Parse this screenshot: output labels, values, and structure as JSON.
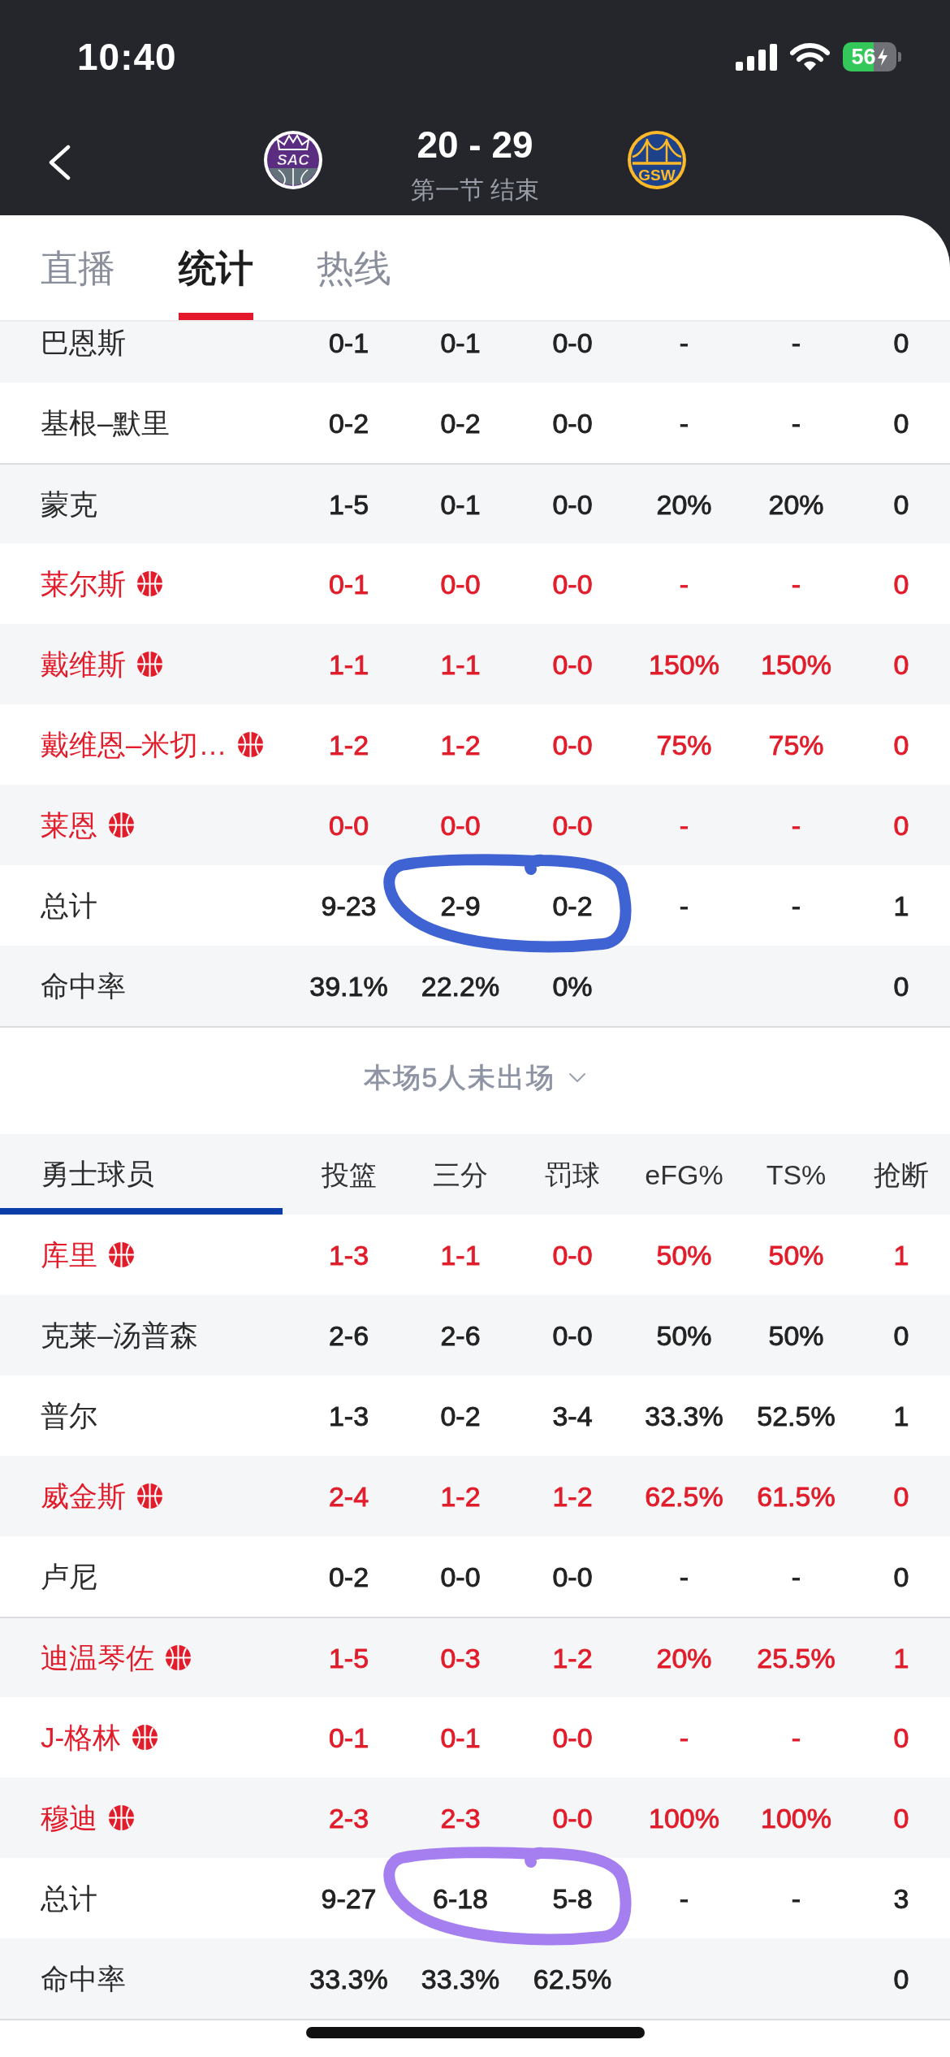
{
  "status_bar": {
    "time": "10:40",
    "battery": "56"
  },
  "header": {
    "home": {
      "logo_text": "SAC"
    },
    "score": "20 - 29",
    "period": "第一节 结束",
    "away": {
      "logo_text": "GSW"
    }
  },
  "tabs": [
    {
      "label": "直播",
      "selected": false
    },
    {
      "label": "统计",
      "selected": true
    },
    {
      "label": "热线",
      "selected": false
    }
  ],
  "tables": [
    {
      "groups": [
        {
          "players": [
            {
              "name": "巴恩斯",
              "on_court": false,
              "stats": [
                "0-1",
                "0-1",
                "0-0",
                "-",
                "-",
                "0"
              ]
            },
            {
              "name": "基根–默里",
              "on_court": false,
              "stats": [
                "0-2",
                "0-2",
                "0-0",
                "-",
                "-",
                "0"
              ]
            }
          ]
        },
        {
          "players": [
            {
              "name": "蒙克",
              "on_court": false,
              "stats": [
                "1-5",
                "0-1",
                "0-0",
                "20%",
                "20%",
                "0"
              ]
            },
            {
              "name": "莱尔斯",
              "on_court": true,
              "stats": [
                "0-1",
                "0-0",
                "0-0",
                "-",
                "-",
                "0"
              ]
            },
            {
              "name": "戴维斯",
              "on_court": true,
              "stats": [
                "1-1",
                "1-1",
                "0-0",
                "150%",
                "150%",
                "0"
              ]
            },
            {
              "name": "戴维恩–米切…",
              "on_court": true,
              "stats": [
                "1-2",
                "1-2",
                "0-0",
                "75%",
                "75%",
                "0"
              ]
            },
            {
              "name": "莱恩",
              "on_court": true,
              "stats": [
                "0-0",
                "0-0",
                "0-0",
                "-",
                "-",
                "0"
              ]
            }
          ]
        }
      ],
      "total": {
        "label": "总计",
        "stats": [
          "9-23",
          "2-9",
          "0-2",
          "-",
          "-",
          "1"
        ],
        "annotation": {
          "kind": "ring",
          "color": "#4063d4"
        }
      },
      "rate": {
        "label": "命中率",
        "field_goals": "39.1%",
        "three_pointers": "22.2%",
        "free_throws": "0%",
        "steals": "0"
      },
      "inactive_note": {
        "label": "本场5人未出场",
        "expanded": false
      }
    },
    {
      "header": {
        "title": "勇士球员",
        "columns": [
          "投篮",
          "三分",
          "罚球",
          "eFG%",
          "TS%",
          "抢断"
        ]
      },
      "groups": [
        {
          "players": [
            {
              "name": "库里",
              "on_court": true,
              "stats": [
                "1-3",
                "1-1",
                "0-0",
                "50%",
                "50%",
                "1"
              ]
            },
            {
              "name": "克莱–汤普森",
              "on_court": false,
              "stats": [
                "2-6",
                "2-6",
                "0-0",
                "50%",
                "50%",
                "0"
              ]
            },
            {
              "name": "普尔",
              "on_court": false,
              "stats": [
                "1-3",
                "0-2",
                "3-4",
                "33.3%",
                "52.5%",
                "1"
              ]
            },
            {
              "name": "威金斯",
              "on_court": true,
              "stats": [
                "2-4",
                "1-2",
                "1-2",
                "62.5%",
                "61.5%",
                "0"
              ]
            },
            {
              "name": "卢尼",
              "on_court": false,
              "stats": [
                "0-2",
                "0-0",
                "0-0",
                "-",
                "-",
                "0"
              ]
            }
          ]
        },
        {
          "players": [
            {
              "name": "迪温琴佐",
              "on_court": true,
              "stats": [
                "1-5",
                "0-3",
                "1-2",
                "20%",
                "25.5%",
                "1"
              ]
            },
            {
              "name": "J-格林",
              "on_court": true,
              "stats": [
                "0-1",
                "0-1",
                "0-0",
                "-",
                "-",
                "0"
              ]
            },
            {
              "name": "穆迪",
              "on_court": true,
              "stats": [
                "2-3",
                "2-3",
                "0-0",
                "100%",
                "100%",
                "0"
              ]
            }
          ]
        }
      ],
      "total": {
        "label": "总计",
        "stats": [
          "9-27",
          "6-18",
          "5-8",
          "-",
          "-",
          "3"
        ],
        "annotation": {
          "kind": "ring",
          "color": "#a57ff0"
        }
      },
      "rate": {
        "label": "命中率",
        "field_goals": "33.3%",
        "three_pointers": "33.3%",
        "free_throws": "62.5%",
        "steals": "0"
      }
    }
  ]
}
